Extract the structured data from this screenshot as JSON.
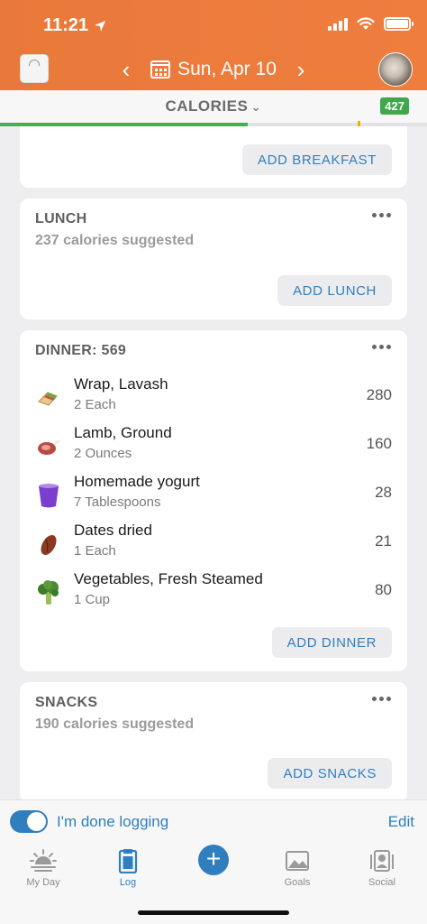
{
  "status_bar": {
    "time": "11:21"
  },
  "header": {
    "date": "Sun, Apr 10"
  },
  "calories_bar": {
    "title": "CALORIES",
    "remaining": "427",
    "progress_fraction": 0.58
  },
  "breakfast": {
    "add_label": "ADD BREAKFAST"
  },
  "lunch": {
    "title": "LUNCH",
    "suggested": "237 calories suggested",
    "add_label": "ADD LUNCH"
  },
  "dinner": {
    "title": "DINNER: 569",
    "add_label": "ADD DINNER",
    "items": [
      {
        "name": "Wrap, Lavash",
        "serving": "2 Each",
        "calories": "280",
        "icon": "wrap-icon"
      },
      {
        "name": "Lamb, Ground",
        "serving": "2 Ounces",
        "calories": "160",
        "icon": "meat-icon"
      },
      {
        "name": "Homemade yogurt",
        "serving": "7 Tablespoons",
        "calories": "28",
        "icon": "cup-icon"
      },
      {
        "name": "Dates dried",
        "serving": "1 Each",
        "calories": "21",
        "icon": "date-fruit-icon"
      },
      {
        "name": "Vegetables, Fresh Steamed",
        "serving": "1 Cup",
        "calories": "80",
        "icon": "broccoli-icon"
      }
    ]
  },
  "snacks": {
    "title": "SNACKS",
    "suggested": "190 calories suggested",
    "add_label": "ADD SNACKS"
  },
  "done_bar": {
    "toggle_on": true,
    "label": "I'm done logging",
    "edit_label": "Edit"
  },
  "tabs": [
    {
      "label": "My Day",
      "icon": "sunrise-icon"
    },
    {
      "label": "Log",
      "icon": "clipboard-icon",
      "active": true
    },
    {
      "label": "",
      "icon": "plus-icon"
    },
    {
      "label": "Goals",
      "icon": "goals-icon"
    },
    {
      "label": "Social",
      "icon": "social-icon"
    }
  ],
  "colors": {
    "header_orange": "#ec7a3c",
    "accent_blue": "#2f7fbf",
    "progress_green": "#46ae52"
  }
}
